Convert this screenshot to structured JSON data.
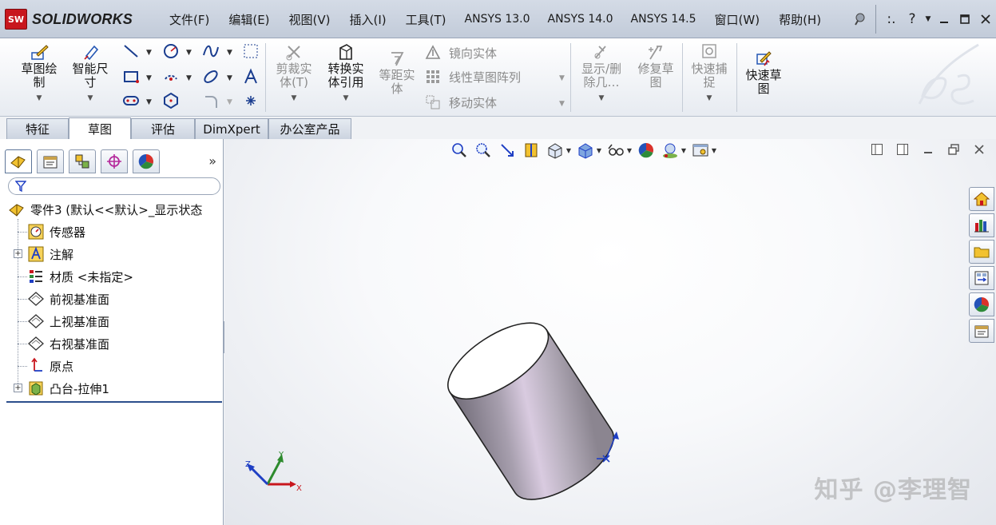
{
  "app": {
    "brand_badge": "SW",
    "brand_name": "SOLIDWORKS"
  },
  "menu": {
    "items": [
      "文件(F)",
      "编辑(E)",
      "视图(V)",
      "插入(I)",
      "工具(T)",
      "ANSYS 13.0",
      "ANSYS 14.0",
      "ANSYS 14.5",
      "窗口(W)",
      "帮助(H)"
    ],
    "help_symbol": "?",
    "more_symbol": ":."
  },
  "ribbon": {
    "sketch_label": "草图绘\n制",
    "smart_dim_label": "智能尺\n寸",
    "trim_label": "剪裁实\n体(T)",
    "convert_label": "转换实\n体引用",
    "offset_label": "等距实\n体",
    "mirror_label": "镜向实体",
    "linear_pattern_label": "线性草图阵列",
    "move_label": "移动实体",
    "show_delete_label": "显示/删\n除几…",
    "repair_label": "修复草\n图",
    "quick_snap_label": "快速捕\n捉",
    "rapid_sketch_label": "快速草\n图"
  },
  "tabs": [
    "特征",
    "草图",
    "评估",
    "DimXpert",
    "办公室产品"
  ],
  "active_tab": "草图",
  "panel": {
    "more": "»",
    "root": "零件3  (默认<<默认>_显示状态",
    "items": [
      "传感器",
      "注解",
      "材质 <未指定>",
      "前视基准面",
      "上视基准面",
      "右视基准面",
      "原点",
      "凸台-拉伸1"
    ]
  },
  "triad": {
    "x": "X",
    "y": "Y",
    "z": "Z"
  },
  "watermark": "知乎 @李理智",
  "colors": {
    "accent": "#2c4f8c",
    "cylinder_top": "#ffffff",
    "cylinder_side": "#a79fae",
    "axis_x": "#c8161d",
    "axis_y": "#2d8a2d",
    "axis_z": "#1f3fc4"
  }
}
